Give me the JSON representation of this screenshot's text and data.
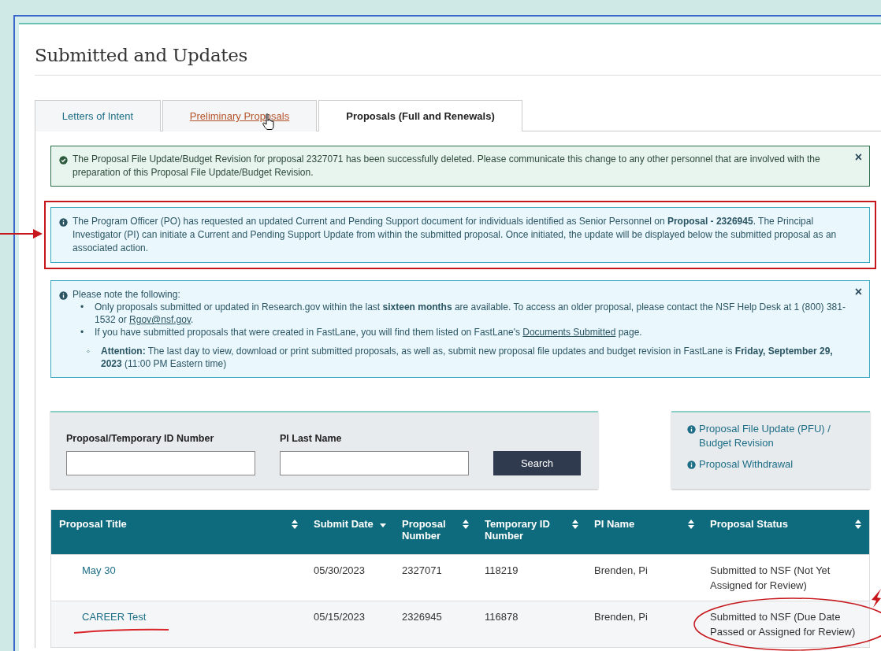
{
  "page": {
    "title": "Submitted and Updates"
  },
  "tabs": [
    {
      "label": "Letters of Intent",
      "selected": false,
      "hovered": false
    },
    {
      "label": "Preliminary Proposals",
      "selected": false,
      "hovered": true
    },
    {
      "label": "Proposals (Full and Renewals)",
      "selected": true,
      "hovered": false
    }
  ],
  "alerts": [
    {
      "kind": "success",
      "close": "×",
      "highlighted": false,
      "paragraphs": [
        [
          {
            "kind": "text",
            "text": "The Proposal File Update/Budget Revision for proposal 2327071 has been successfully deleted. Please communicate this change to any other personnel that are involved with the preparation of this Proposal File Update/Budget Revision."
          }
        ]
      ]
    },
    {
      "kind": "info",
      "highlighted": true,
      "paragraphs": [
        [
          {
            "kind": "text",
            "text": "The Program Officer (PO) has requested an updated Current and Pending Support document for individuals identified as Senior Personnel on "
          },
          {
            "kind": "bold",
            "text": "Proposal - 2326945"
          },
          {
            "kind": "text",
            "text": ". The Principal Investigator (PI) can initiate a Current and Pending Support Update from within the submitted proposal. Once initiated, the update will be displayed below the submitted proposal as an associated action."
          }
        ]
      ]
    },
    {
      "kind": "info",
      "close": "×",
      "highlighted": false,
      "paragraphs": [
        [
          {
            "kind": "text",
            "text": "Please note the following:"
          }
        ]
      ],
      "items": [
        {
          "marker": "•",
          "parts": [
            {
              "kind": "text",
              "text": "Only proposals submitted or updated in Research.gov within the last "
            },
            {
              "kind": "bold",
              "text": "sixteen months"
            },
            {
              "kind": "text",
              "text": " are available. To access an older proposal, please contact the NSF Help Desk at 1 (800) 381-1532 or "
            },
            {
              "kind": "link",
              "text": "Rgov@nsf.gov"
            },
            {
              "kind": "text",
              "text": "."
            }
          ]
        },
        {
          "marker": "•",
          "parts": [
            {
              "kind": "text",
              "text": "If you have submitted proposals that were created in FastLane, you will find them listed on FastLane's "
            },
            {
              "kind": "link",
              "text": "Documents Submitted"
            },
            {
              "kind": "text",
              "text": " page."
            }
          ],
          "children": [
            {
              "marker": "◦",
              "parts": [
                {
                  "kind": "bold",
                  "text": "Attention:"
                },
                {
                  "kind": "text",
                  "text": " The last day to view, download or print submitted proposals, as well as, submit new proposal file updates and budget revision in FastLane is "
                },
                {
                  "kind": "bold",
                  "text": "Friday, September 29, 2023"
                },
                {
                  "kind": "text",
                  "text": " (11:00 PM Eastern time)"
                }
              ]
            }
          ]
        }
      ]
    }
  ],
  "search": {
    "fields": [
      {
        "label": "Proposal/Temporary ID Number"
      },
      {
        "label": "PI Last Name"
      }
    ],
    "button": "Search"
  },
  "side_links": [
    "Proposal File Update (PFU) / Budget Revision",
    "Proposal Withdrawal"
  ],
  "table": {
    "columns": [
      {
        "label": "Proposal Title",
        "sorted": false
      },
      {
        "label": "Submit Date",
        "sorted": true
      },
      {
        "label": "Proposal Number",
        "sorted": false
      },
      {
        "label": "Temporary ID Number",
        "sorted": false
      },
      {
        "label": "PI Name",
        "sorted": false
      },
      {
        "label": "Proposal Status",
        "sorted": false
      }
    ],
    "rows": [
      {
        "cells": [
          "May 30",
          "05/30/2023",
          "2327071",
          "118219",
          "Brenden, Pi",
          "Submitted to NSF (Not Yet Assigned for Review)"
        ],
        "title_underlined": false,
        "status_circled": false
      },
      {
        "cells": [
          "CAREER Test",
          "05/15/2023",
          "2326945",
          "116878",
          "Brenden, Pi",
          "Submitted to NSF (Due Date Passed or Assigned for Review)"
        ],
        "title_underlined": true,
        "status_circled": true
      }
    ]
  }
}
